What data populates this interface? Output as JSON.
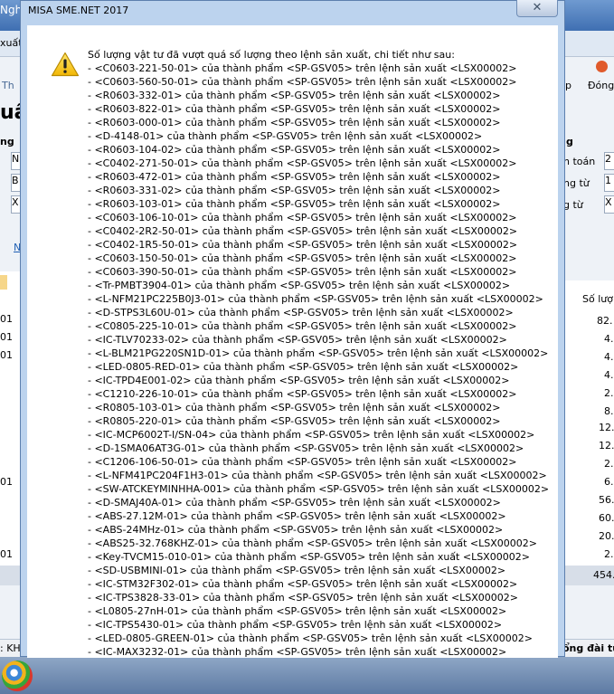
{
  "background": {
    "title_fragment": "Nghi",
    "menu_fragment": "xuất",
    "toolbar_left": "Th",
    "toolbar_right_1": "p",
    "toolbar_right_2": "Đóng",
    "heading_fragment": "uất",
    "label_fragment": "ng",
    "right_labels": [
      "h toán",
      "ng từ",
      "g từ"
    ],
    "right_values": [
      "2",
      "1",
      "X"
    ],
    "left_inputs": [
      "N",
      "B",
      "X"
    ],
    "left_link": "N",
    "column_header": "Số lượ",
    "left_row_fragments": [
      "01",
      "01",
      "01",
      "01",
      "01"
    ],
    "quantities": [
      "82.",
      "4.",
      "4.",
      "4.",
      "2.",
      "8.",
      "12.",
      "12.",
      "2.",
      "6.",
      "56.",
      "60.",
      "20.",
      "2."
    ],
    "total": "454.",
    "status_left": ": KH",
    "status_right": "ổng đài tư"
  },
  "dialog": {
    "title": "MISA SME.NET 2017",
    "close_label": "✕",
    "header": "Số lượng vật tư đã vượt quá số lượng theo lệnh sản xuất, chi tiết như sau:",
    "lines": [
      "- <C0603-221-50-01> của thành phẩm <SP-GSV05> trên lệnh sản xuất <LSX00002>",
      "- <C0603-560-50-01> của thành phẩm <SP-GSV05> trên lệnh sản xuất <LSX00002>",
      "- <R0603-332-01> của thành phẩm <SP-GSV05> trên lệnh sản xuất <LSX00002>",
      "- <R0603-822-01> của thành phẩm <SP-GSV05> trên lệnh sản xuất <LSX00002>",
      "- <R0603-000-01> của thành phẩm <SP-GSV05> trên lệnh sản xuất <LSX00002>",
      "- <D-4148-01> của thành phẩm <SP-GSV05> trên lệnh sản xuất <LSX00002>",
      "- <R0603-104-02> của thành phẩm <SP-GSV05> trên lệnh sản xuất <LSX00002>",
      "- <C0402-271-50-01> của thành phẩm <SP-GSV05> trên lệnh sản xuất <LSX00002>",
      "- <R0603-472-01> của thành phẩm <SP-GSV05> trên lệnh sản xuất <LSX00002>",
      "- <R0603-331-02> của thành phẩm <SP-GSV05> trên lệnh sản xuất <LSX00002>",
      "- <R0603-103-01> của thành phẩm <SP-GSV05> trên lệnh sản xuất <LSX00002>",
      "- <C0603-106-10-01> của thành phẩm <SP-GSV05> trên lệnh sản xuất <LSX00002>",
      "- <C0402-2R2-50-01> của thành phẩm <SP-GSV05> trên lệnh sản xuất <LSX00002>",
      "- <C0402-1R5-50-01> của thành phẩm <SP-GSV05> trên lệnh sản xuất <LSX00002>",
      "- <C0603-150-50-01> của thành phẩm <SP-GSV05> trên lệnh sản xuất <LSX00002>",
      "- <C0603-390-50-01> của thành phẩm <SP-GSV05> trên lệnh sản xuất <LSX00002>",
      "- <Tr-PMBT3904-01> của thành phẩm <SP-GSV05> trên lệnh sản xuất <LSX00002>",
      "- <L-NFM21PC225B0J3-01> của thành phẩm <SP-GSV05> trên lệnh sản xuất <LSX00002>",
      "- <D-STPS3L60U-01> của thành phẩm <SP-GSV05> trên lệnh sản xuất <LSX00002>",
      "- <C0805-225-10-01> của thành phẩm <SP-GSV05> trên lệnh sản xuất <LSX00002>",
      "- <IC-TLV70233-02> của thành phẩm <SP-GSV05> trên lệnh sản xuất <LSX00002>",
      "- <L-BLM21PG220SN1D-01> của thành phẩm <SP-GSV05> trên lệnh sản xuất <LSX00002>",
      "- <LED-0805-RED-01> của thành phẩm <SP-GSV05> trên lệnh sản xuất <LSX00002>",
      "- <IC-TPD4E001-02> của thành phẩm <SP-GSV05> trên lệnh sản xuất <LSX00002>",
      "- <C1210-226-10-01> của thành phẩm <SP-GSV05> trên lệnh sản xuất <LSX00002>",
      "- <R0805-103-01> của thành phẩm <SP-GSV05> trên lệnh sản xuất <LSX00002>",
      "- <R0805-220-01> của thành phẩm <SP-GSV05> trên lệnh sản xuất <LSX00002>",
      "- <IC-MCP6002T-I/SN-04> của thành phẩm <SP-GSV05> trên lệnh sản xuất <LSX00002>",
      "- <D-1SMA06AT3G-01> của thành phẩm <SP-GSV05> trên lệnh sản xuất <LSX00002>",
      "- <C1206-106-50-01> của thành phẩm <SP-GSV05> trên lệnh sản xuất <LSX00002>",
      "- <L-NFM41PC204F1H3-01> của thành phẩm <SP-GSV05> trên lệnh sản xuất <LSX00002>",
      "- <SW-ATCKEYMINHHA-001> của thành phẩm <SP-GSV05> trên lệnh sản xuất <LSX00002>",
      "- <D-SMAJ40A-01> của thành phẩm <SP-GSV05> trên lệnh sản xuất <LSX00002>",
      "- <ABS-27.12M-01> của thành phẩm <SP-GSV05> trên lệnh sản xuất <LSX00002>",
      "- <ABS-24MHz-01> của thành phẩm <SP-GSV05> trên lệnh sản xuất <LSX00002>",
      "- <ABS25-32.768KHZ-01> của thành phẩm <SP-GSV05> trên lệnh sản xuất <LSX00002>",
      "- <Key-TVCM15-010-01> của thành phẩm <SP-GSV05> trên lệnh sản xuất <LSX00002>",
      "- <SD-USBMINI-01> của thành phẩm <SP-GSV05> trên lệnh sản xuất <LSX00002>",
      "- <IC-STM32F302-01> của thành phẩm <SP-GSV05> trên lệnh sản xuất <LSX00002>",
      "- <IC-TPS3828-33-01> của thành phẩm <SP-GSV05> trên lệnh sản xuất <LSX00002>",
      "- <L0805-27nH-01> của thành phẩm <SP-GSV05> trên lệnh sản xuất <LSX00002>",
      "- <IC-TPS5430-01> của thành phẩm <SP-GSV05> trên lệnh sản xuất <LSX00002>",
      "- <LED-0805-GREEN-01> của thành phẩm <SP-GSV05> trên lệnh sản xuất <LSX00002>",
      "- <IC-MAX3232-01> của thành phẩm <SP-GSV05> trên lệnh sản xuất <LSX00002>"
    ]
  }
}
